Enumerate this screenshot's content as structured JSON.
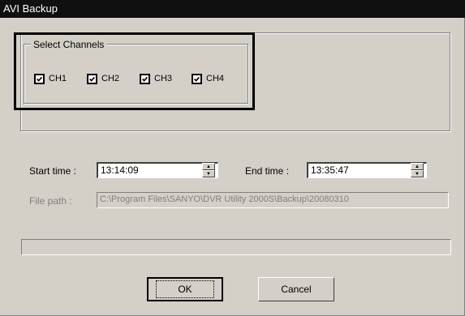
{
  "window": {
    "title": "AVI Backup"
  },
  "select_channels": {
    "label": "Select Channels",
    "channels": [
      {
        "label": "CH1",
        "checked": true
      },
      {
        "label": "CH2",
        "checked": true
      },
      {
        "label": "CH3",
        "checked": true
      },
      {
        "label": "CH4",
        "checked": true
      }
    ]
  },
  "start_time": {
    "label": "Start time :",
    "value": "13:14:09"
  },
  "end_time": {
    "label": "End time :",
    "value": "13:35:47"
  },
  "file_path": {
    "label": "File path :",
    "value": "C:\\Program Files\\SANYO\\DVR Utility 2000S\\Backup\\20080310"
  },
  "buttons": {
    "ok": "OK",
    "cancel": "Cancel"
  },
  "colors": {
    "title_bar": "#101010",
    "window_bg": "#d4d0c8",
    "highlight_border": "#000000"
  }
}
